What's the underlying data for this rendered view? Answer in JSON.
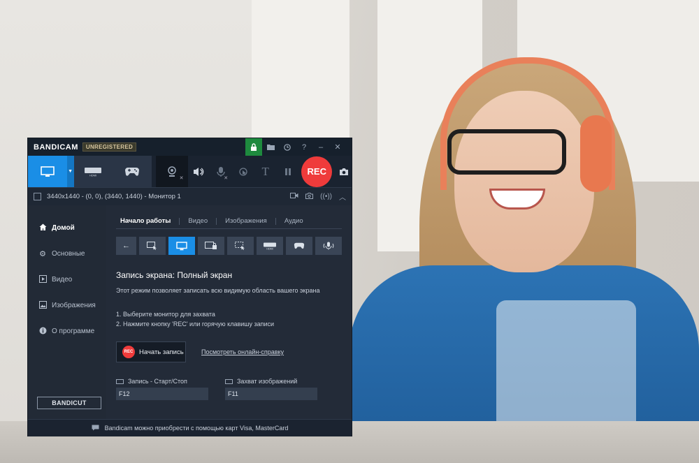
{
  "window": {
    "brand": "BANDICAM",
    "registration_badge": "UNREGISTERED"
  },
  "titlebar_icons": [
    "lock-icon",
    "folder-icon",
    "clock-icon",
    "help-icon",
    "minimize-icon",
    "close-icon"
  ],
  "toolbar": {
    "rec_label": "REC"
  },
  "infobar": {
    "capture_area_text": "3440x1440 - (0, 0), (3440, 1440) - Монитор 1"
  },
  "sidebar": {
    "items": [
      {
        "label": "Домой",
        "icon": "home-icon",
        "active": true
      },
      {
        "label": "Основные",
        "icon": "gear-icon",
        "active": false
      },
      {
        "label": "Видео",
        "icon": "video-icon",
        "active": false
      },
      {
        "label": "Изображения",
        "icon": "image-icon",
        "active": false
      },
      {
        "label": "О программе",
        "icon": "info-icon",
        "active": false
      }
    ],
    "bandicut_label": "BANDICUT"
  },
  "tabs": [
    {
      "label": "Начало работы",
      "active": true
    },
    {
      "label": "Видео",
      "active": false
    },
    {
      "label": "Изображения",
      "active": false
    },
    {
      "label": "Аудио",
      "active": false
    }
  ],
  "main": {
    "title": "Запись экрана: Полный экран",
    "description": "Этот режим позволяет записать всю видимую область вашего экрана",
    "step1": "1. Выберите монитор для захвата",
    "step2": "2. Нажмите кнопку 'REC' или горячую клавишу записи",
    "start_button_badge": "REC",
    "start_button_label": "Начать запись",
    "help_link": "Посмотреть онлайн-справку"
  },
  "hotkeys": {
    "record_label": "Запись - Старт/Стоп",
    "record_value": "F12",
    "capture_label": "Захват изображений",
    "capture_value": "F11"
  },
  "footer": {
    "text": "Bandicam можно приобрести с помощью карт Visa, MasterCard"
  },
  "colors": {
    "accent": "#1a8ee6",
    "rec_red": "#ef3b3b",
    "window_bg": "#232b38"
  }
}
